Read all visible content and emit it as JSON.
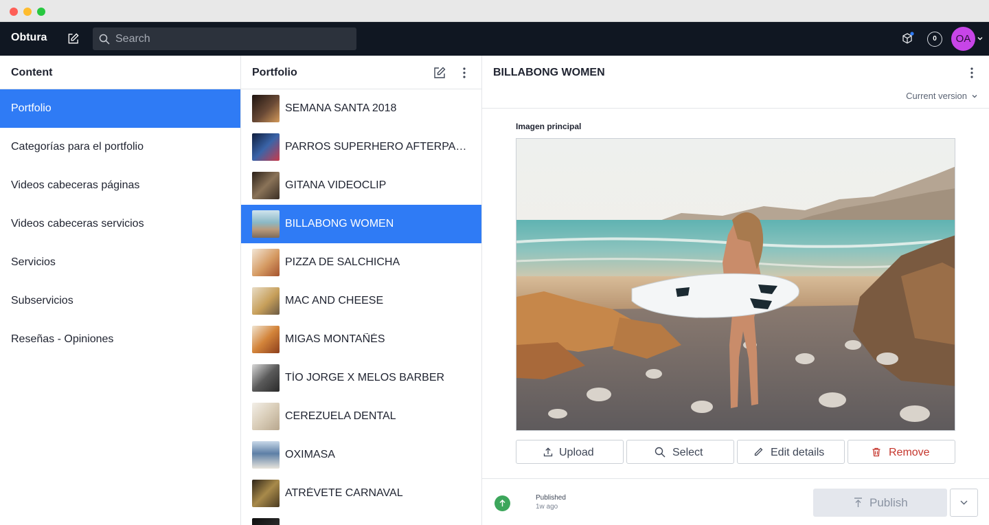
{
  "topbar": {
    "brand": "Obtura",
    "search_placeholder": "Search",
    "notification_count": "0",
    "avatar_initials": "OA"
  },
  "content_pane": {
    "title": "Content",
    "items": [
      {
        "label": "Portfolio",
        "active": true
      },
      {
        "label": "Categorías para el portfolio"
      },
      {
        "label": "Videos cabeceras páginas"
      },
      {
        "label": "Videos cabeceras servicios"
      },
      {
        "label": "Servicios"
      },
      {
        "label": "Subservicios"
      },
      {
        "label": "Reseñas - Opiniones"
      }
    ]
  },
  "list_pane": {
    "title": "Portfolio",
    "items": [
      {
        "title": "SEMANA SANTA 2018",
        "thumb_color": "#3b2a22"
      },
      {
        "title": "PARROS SUPERHERO AFTERPARTY",
        "thumb_color": "#27406e"
      },
      {
        "title": "GITANA VIDEOCLIP",
        "thumb_color": "#5a4736"
      },
      {
        "title": "BILLABONG WOMEN",
        "thumb_color": "#7fa3b5",
        "active": true
      },
      {
        "title": "PIZZA DE SALCHICHA",
        "thumb_color": "#d9b38c"
      },
      {
        "title": "MAC AND CHEESE",
        "thumb_color": "#c9a46a"
      },
      {
        "title": "MIGAS MONTAÑÉS",
        "thumb_color": "#c67c3f"
      },
      {
        "title": "TÍO JORGE X MELOS BARBER",
        "thumb_color": "#4d4d4d"
      },
      {
        "title": "CEREZUELA DENTAL",
        "thumb_color": "#e4ddd2"
      },
      {
        "title": "OXIMASA",
        "thumb_color": "#8fa2b8"
      },
      {
        "title": "ATRÉVETE CARNAVAL",
        "thumb_color": "#6b5a3a"
      },
      {
        "title": "",
        "thumb_color": "#1c1c1c"
      }
    ]
  },
  "document": {
    "title": "BILLABONG WOMEN",
    "version": "Current version",
    "field_label": "Imagen principal",
    "actions": {
      "upload": "Upload",
      "select": "Select",
      "edit": "Edit details",
      "remove": "Remove"
    },
    "status": "Published",
    "status_time": "1w ago",
    "publish": "Publish"
  },
  "colors": {
    "accent": "#2f7bf5",
    "topbar": "#101722",
    "avatar": "#c745e8",
    "published": "#3ca65b",
    "danger": "#c5362d"
  }
}
